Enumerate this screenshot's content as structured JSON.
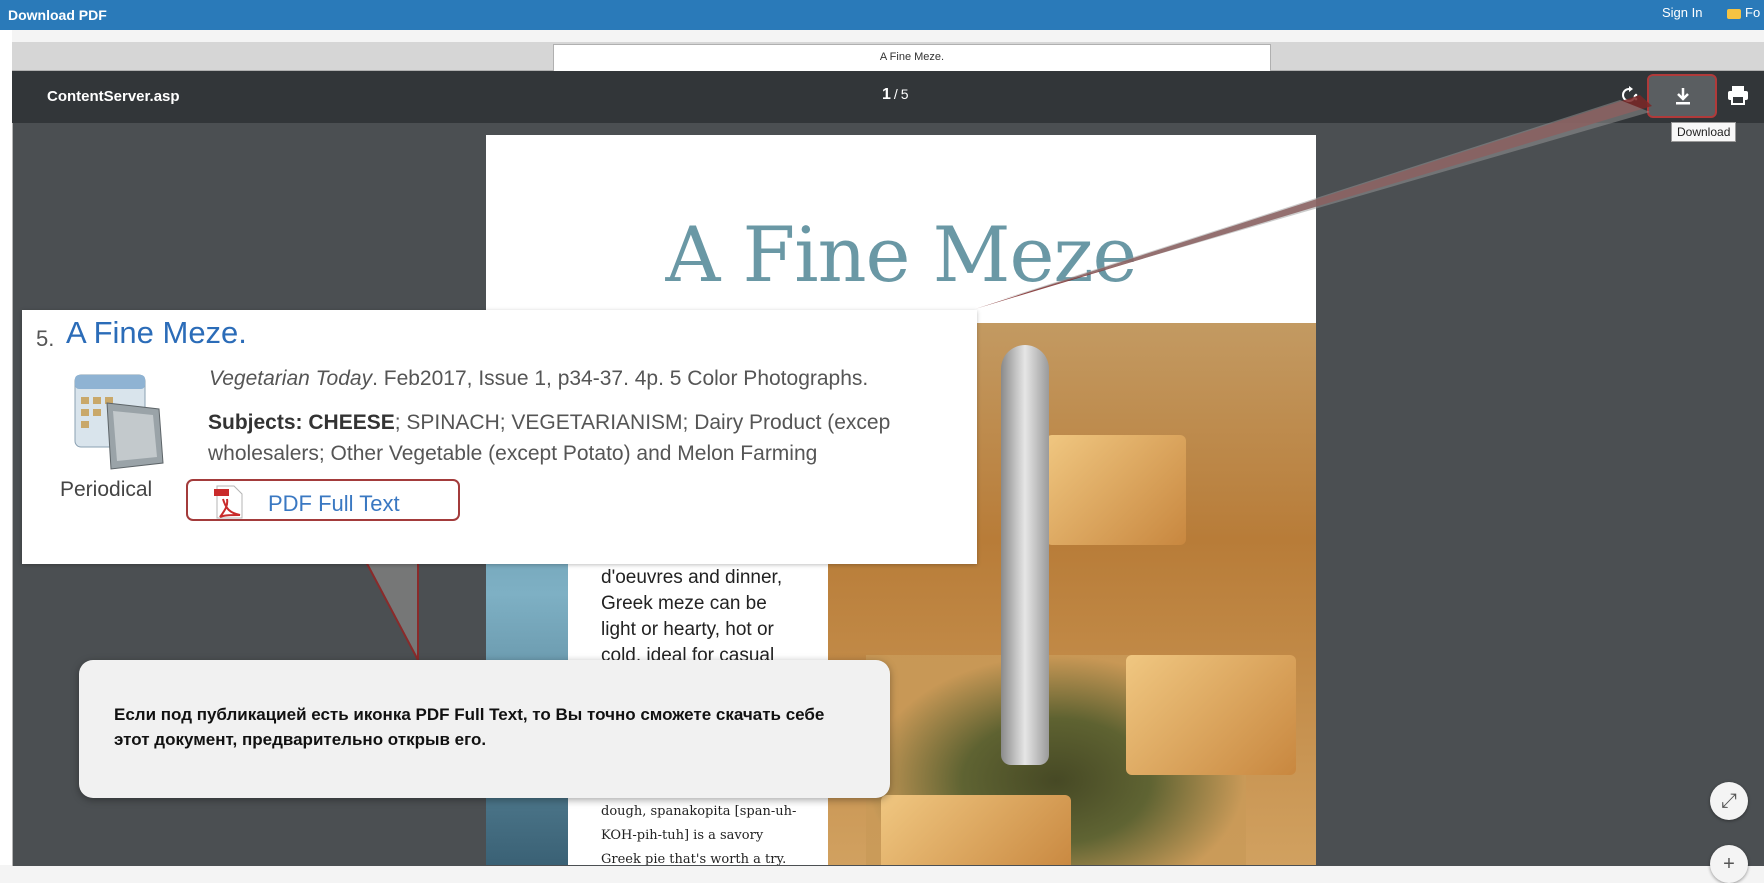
{
  "topbar": {
    "title": "Download PDF",
    "signin": "Sign In",
    "folder": "Fo"
  },
  "tab": {
    "title": "A Fine Meze."
  },
  "viewer": {
    "file_name": "ContentServer.asp",
    "page_current": "1",
    "page_sep": "/",
    "page_total": "5",
    "download_tooltip": "Download"
  },
  "pdf_page": {
    "title": "A Fine Meze",
    "text_large": [
      "d'oeuvres and dinner,",
      "Greek meze can be",
      "light or hearty, hot or",
      "cold, ideal for casual"
    ],
    "text_small": [
      "dough, spanakopita [span-uh-",
      "KOH-pih-tuh] is a savory",
      "Greek pie that's worth a try."
    ]
  },
  "result": {
    "number": "5.",
    "title": "A Fine Meze.",
    "type": "Periodical",
    "source_pub": "Vegetarian Today",
    "source_rest": ". Feb2017, Issue 1, p34-37. 4p. 5 Color Photographs.",
    "subjects_label": "Subjects: ",
    "subjects_first": "CHEESE",
    "subjects_rest": "; SPINACH; VEGETARIANISM; Dairy Product (excep wholesalers; Other Vegetable (except Potato) and Melon Farming",
    "pdf_link": "PDF Full Text"
  },
  "callout": {
    "text": "Если под публикацией есть иконка PDF Full Text, то Вы точно сможете скачать себе этот документ, предварительно открыв его."
  },
  "colors": {
    "accent": "#2a7ab9",
    "highlight": "#a33b3b",
    "link": "#2b6cb8"
  },
  "icons": [
    "download-icon",
    "print-icon",
    "rotate-icon",
    "pdf-icon",
    "periodical-icon",
    "fit-page-icon",
    "zoom-in-icon"
  ]
}
